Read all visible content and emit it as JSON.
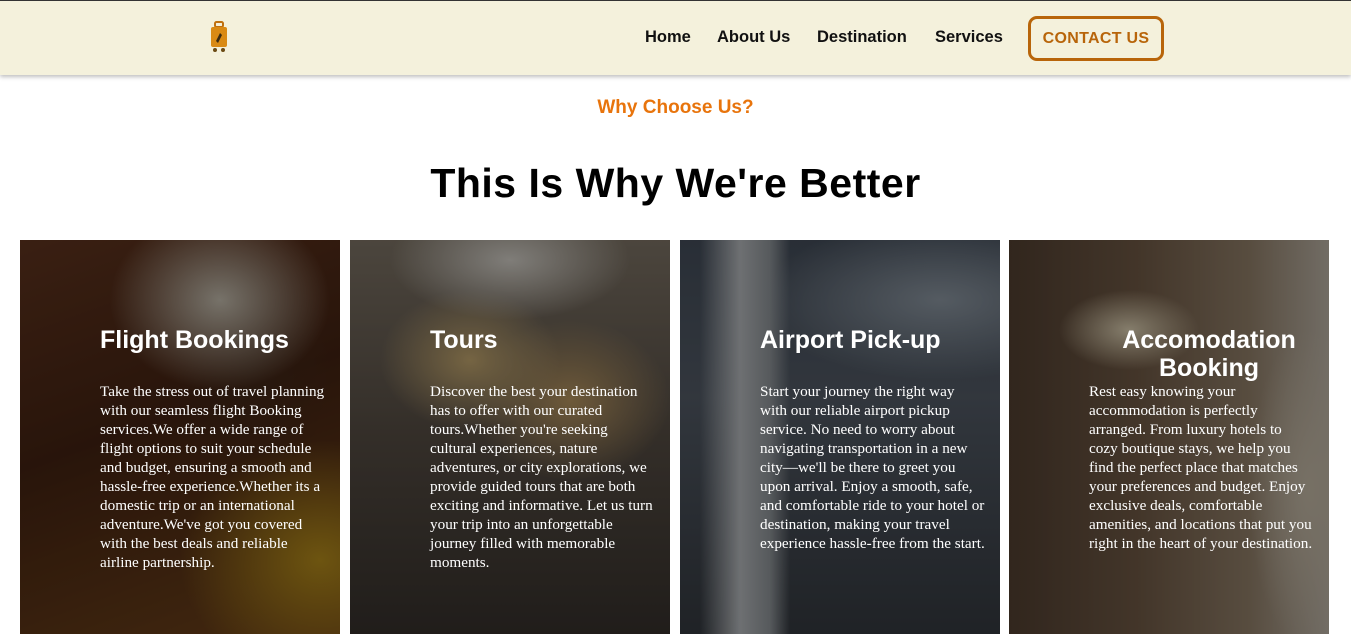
{
  "header": {
    "logo_icon": "suitcase-icon",
    "nav": [
      "Home",
      "About Us",
      "Destination",
      "Services"
    ],
    "contact_label": "CONTACT US",
    "accent": "#b8650a"
  },
  "section": {
    "eyebrow": "Why Choose Us?",
    "heading": "This Is Why We're Better"
  },
  "cards": [
    {
      "title": "Flight Bookings",
      "text": "Take the stress out of travel planning with our seamless flight Booking services.We offer a wide range of flight options to suit your schedule and budget, ensuring a smooth and hassle-free experience.Whether its a domestic trip or an international adventure.We've got you covered with the best deals and reliable airline partnership."
    },
    {
      "title": "Tours",
      "text": "Discover the best your destination has to offer with our curated tours.Whether you're seeking cultural experiences, nature adventures, or city explorations, we provide guided tours that are both exciting and informative. Let us turn your trip into an unforgettable journey filled with memorable moments."
    },
    {
      "title": "Airport Pick-up",
      "text": "Start your journey the right way with our reliable airport pickup service. No need to worry about navigating transportation in a new city—we'll be there to greet you upon arrival. Enjoy a smooth, safe, and comfortable ride to your hotel or destination, making your travel experience hassle-free from the start."
    },
    {
      "title": "Accomodation Booking",
      "text": "Rest easy knowing your accommodation is perfectly arranged. From luxury hotels to cozy boutique stays, we help you find the perfect place that matches your preferences and budget. Enjoy exclusive deals, comfortable amenities, and locations that put you right in the heart of your destination."
    }
  ]
}
